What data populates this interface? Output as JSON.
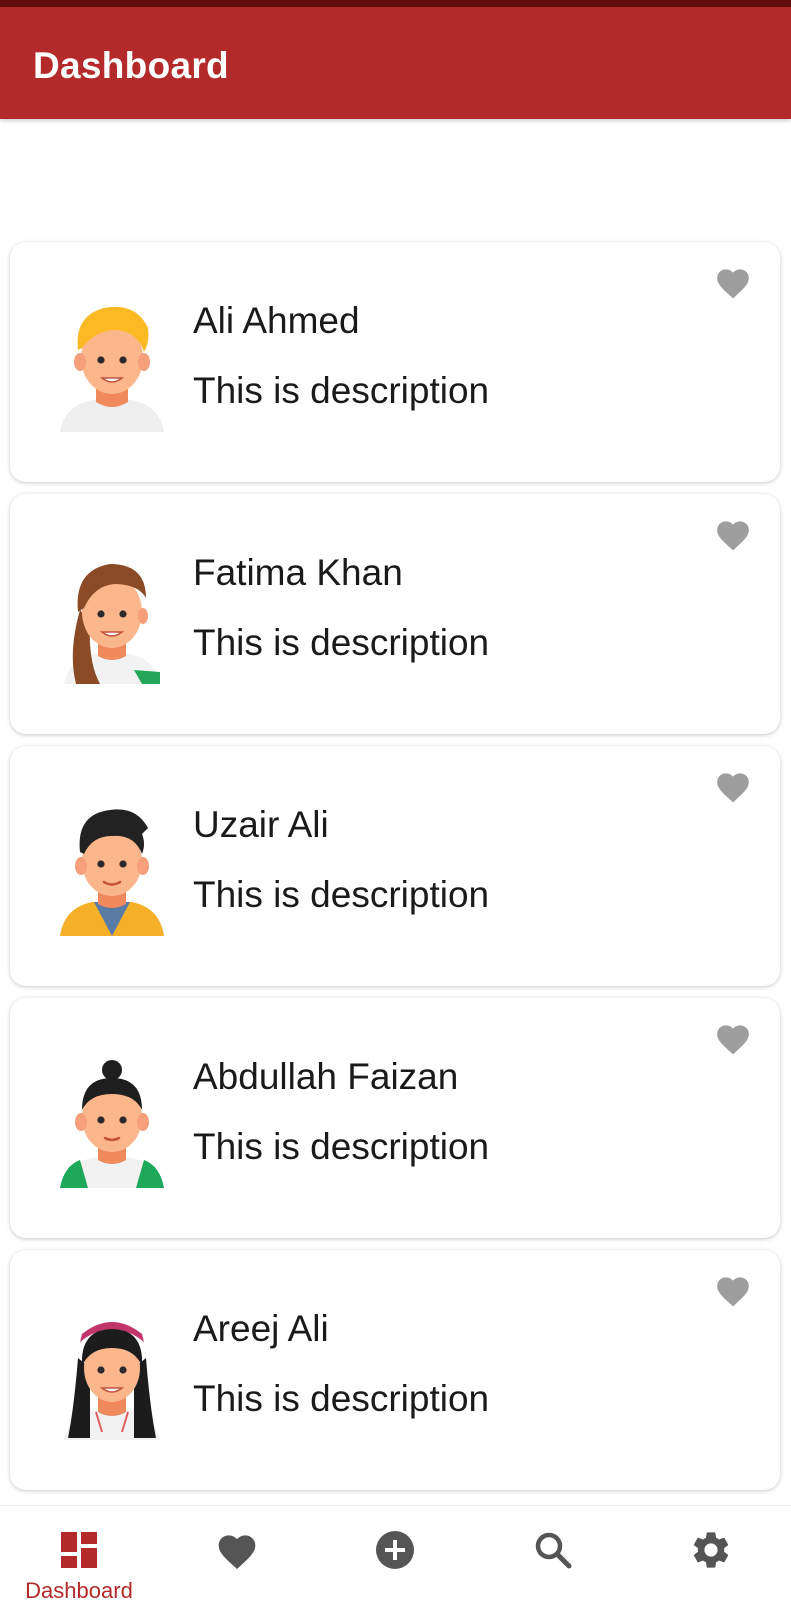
{
  "colors": {
    "primary": "#b42a2a",
    "status_strip": "#5e0c0c",
    "heart_inactive": "#9e9e9e",
    "nav_icon": "#555555"
  },
  "app_bar": {
    "title": "Dashboard"
  },
  "users": [
    {
      "name": "Ali Ahmed",
      "description": "This is description",
      "avatar": "avatar-blond-man",
      "favorite_icon": "heart-icon"
    },
    {
      "name": "Fatima Khan",
      "description": "This is description",
      "avatar": "avatar-brown-hair-woman",
      "favorite_icon": "heart-icon"
    },
    {
      "name": "Uzair Ali",
      "description": "This is description",
      "avatar": "avatar-black-hair-man",
      "favorite_icon": "heart-icon"
    },
    {
      "name": "Abdullah Faizan",
      "description": "This is description",
      "avatar": "avatar-man-bun",
      "favorite_icon": "heart-icon"
    },
    {
      "name": "Areej Ali",
      "description": "This is description",
      "avatar": "avatar-woman-headband",
      "favorite_icon": "heart-icon"
    }
  ],
  "bottom_nav": [
    {
      "icon": "dashboard-icon",
      "label": "Dashboard",
      "active": true
    },
    {
      "icon": "heart-icon",
      "active": false
    },
    {
      "icon": "add-circle-icon",
      "active": false
    },
    {
      "icon": "search-icon",
      "active": false
    },
    {
      "icon": "gear-icon",
      "active": false
    }
  ]
}
